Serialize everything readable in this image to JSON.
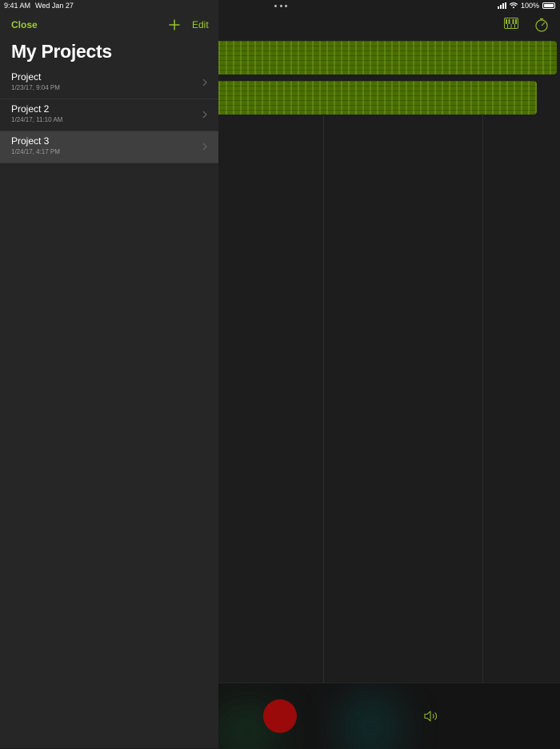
{
  "status_bar": {
    "time": "9:41 AM",
    "date": "Wed Jan 27",
    "battery": "100%"
  },
  "panel": {
    "close_label": "Close",
    "edit_label": "Edit",
    "title": "My Projects",
    "projects": [
      {
        "name": "Project",
        "date": "1/23/17, 9:04 PM",
        "selected": false
      },
      {
        "name": "Project 2",
        "date": "1/24/17, 11:10 AM",
        "selected": false
      },
      {
        "name": "Project 3",
        "date": "1/24/17, 4:17 PM",
        "selected": true
      }
    ]
  },
  "icons": {
    "add": "plus-icon",
    "chevron": "chevron-right-icon",
    "keyboard": "keyboard-icon",
    "timer": "metronome-timer-icon",
    "speaker": "speaker-icon"
  },
  "colors": {
    "accent": "#9ccc2c",
    "region": "#4a6e00",
    "record": "#9a0a0a",
    "panel_bg": "#262626",
    "selected_row": "#3f3f3f"
  }
}
